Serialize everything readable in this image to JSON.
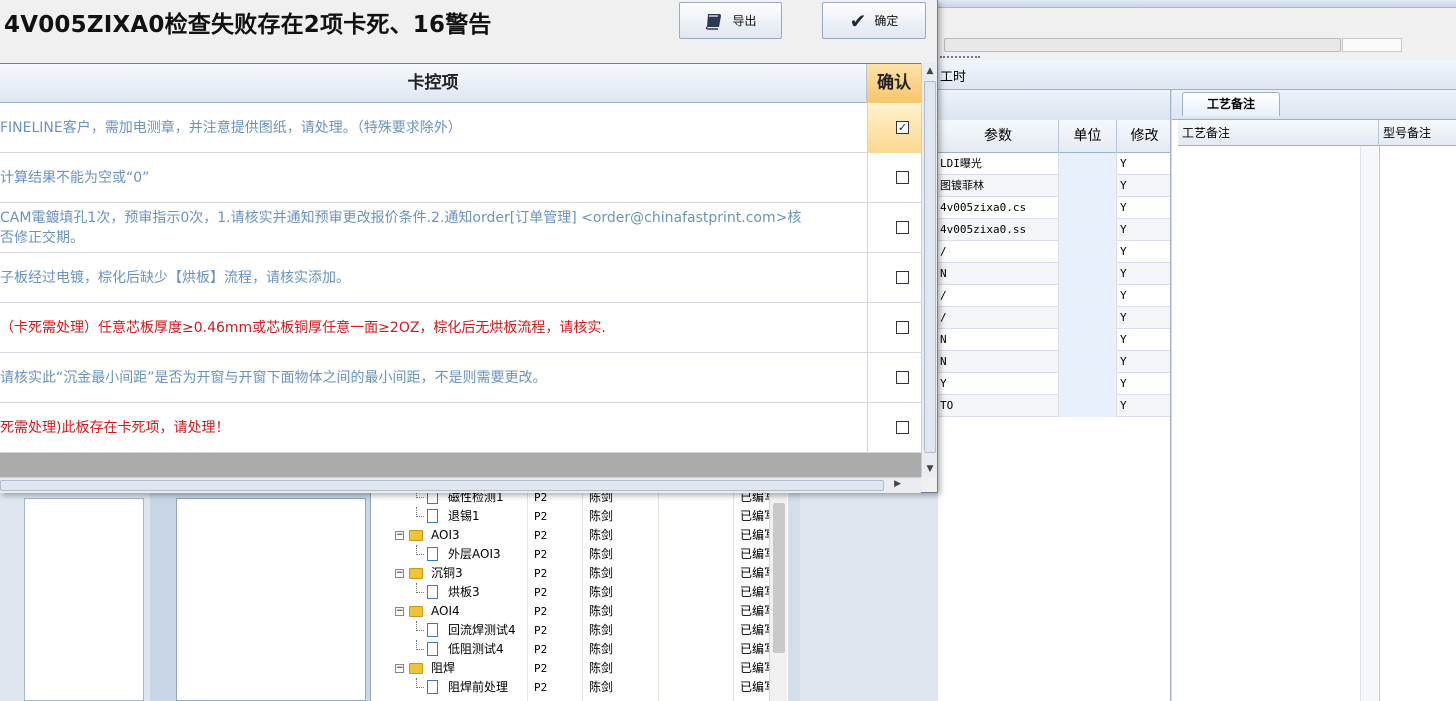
{
  "dialog": {
    "title": "4V005ZIXA0检查失败存在2项卡死、16警告",
    "export_label": "导出",
    "ok_label": "确定",
    "column_item": "卡控项",
    "column_confirm": "确认",
    "rows": [
      {
        "text": "FINELINE客户，需加电测章，并注意提供图纸，请处理。（特殊要求除外）",
        "color": "blue",
        "checked": true
      },
      {
        "text": "计算结果不能为空或“0”",
        "color": "blue",
        "checked": false
      },
      {
        "text": "CAM電鍍填孔1次，预审指示0次，1.请核实并通知预审更改报价条件.2.通知order[订单管理] <order@chinafastprint.com>核\n否修正交期。",
        "color": "blue",
        "checked": false
      },
      {
        "text": "子板经过电镀，棕化后缺少【烘板】流程，请核实添加。",
        "color": "blue",
        "checked": false
      },
      {
        "text": "（卡死需处理）任意芯板厚度≥0.46mm或芯板铜厚任意一面≥2OZ，棕化后无烘板流程，请核实.",
        "color": "red",
        "checked": false
      },
      {
        "text": "请核实此“沉金最小间距”是否为开窗与开窗下面物体之间的最小间距，不是则需要更改。",
        "color": "blue",
        "checked": false
      },
      {
        "text": "死需处理)此板存在卡死项，请处理！",
        "color": "red",
        "checked": false
      }
    ]
  },
  "background": {
    "tab_hours": "工时",
    "right_tab": "工艺备注",
    "right_col1": "工艺备注",
    "right_col2": "型号备注",
    "grid_headers": {
      "param": "参数",
      "unit": "单位",
      "modify": "修改"
    },
    "grid_rows": [
      {
        "param": "LDI曝光",
        "mod": "Y"
      },
      {
        "param": "图镀菲林",
        "mod": "Y"
      },
      {
        "param": "4v005zixa0.cs",
        "mod": "Y"
      },
      {
        "param": "4v005zixa0.ss",
        "mod": "Y"
      },
      {
        "param": "/",
        "mod": "Y"
      },
      {
        "param": "N",
        "mod": "Y"
      },
      {
        "param": "/",
        "mod": "Y"
      },
      {
        "param": "/",
        "mod": "Y"
      },
      {
        "param": "N",
        "mod": "Y"
      },
      {
        "param": "N",
        "mod": "Y"
      },
      {
        "param": "Y",
        "mod": "Y"
      },
      {
        "param": "TO",
        "mod": "Y"
      }
    ],
    "tree_rows": [
      {
        "name": "磁性检测1",
        "kind": "doc",
        "p": "P2",
        "who": "陈剑",
        "stat": "已编写"
      },
      {
        "name": "退锡1",
        "kind": "doc",
        "p": "P2",
        "who": "陈剑",
        "stat": "已编写"
      },
      {
        "name": "AOI3",
        "kind": "folder",
        "p": "P2",
        "who": "陈剑",
        "stat": "已编写"
      },
      {
        "name": "外层AOI3",
        "kind": "doc",
        "p": "P2",
        "who": "陈剑",
        "stat": "已编写"
      },
      {
        "name": "沉铜3",
        "kind": "folder",
        "p": "P2",
        "who": "陈剑",
        "stat": "已编写"
      },
      {
        "name": "烘板3",
        "kind": "doc",
        "p": "P2",
        "who": "陈剑",
        "stat": "已编写"
      },
      {
        "name": "AOI4",
        "kind": "folder",
        "p": "P2",
        "who": "陈剑",
        "stat": "已编写"
      },
      {
        "name": "回流焊测试4",
        "kind": "doc",
        "p": "P2",
        "who": "陈剑",
        "stat": "已编写"
      },
      {
        "name": "低阻测试4",
        "kind": "doc",
        "p": "P2",
        "who": "陈剑",
        "stat": "已编写"
      },
      {
        "name": "阻焊",
        "kind": "folder",
        "p": "P2",
        "who": "陈剑",
        "stat": "已编写"
      },
      {
        "name": "阻焊前处理",
        "kind": "doc",
        "p": "P2",
        "who": "陈剑",
        "stat": "已编写"
      }
    ]
  }
}
